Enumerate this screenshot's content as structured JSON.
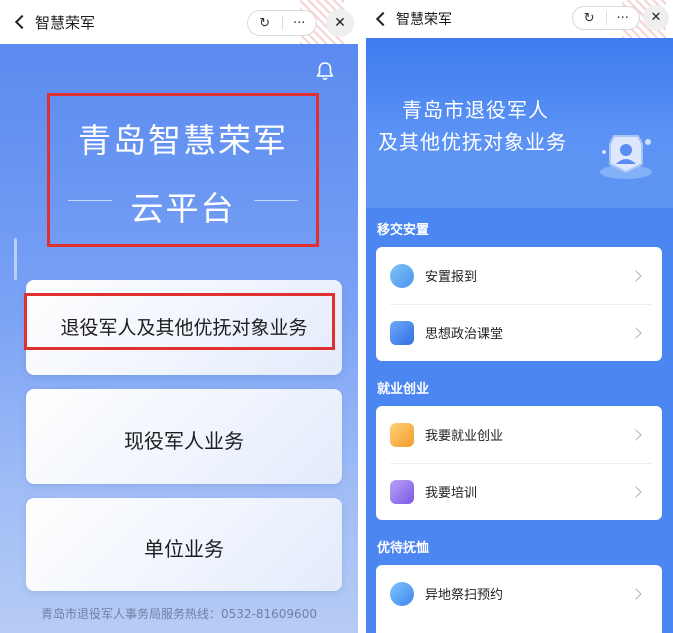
{
  "left": {
    "header_title": "智慧荣军",
    "refresh_glyph": "↻",
    "more_glyph": "···",
    "close_glyph": "✕",
    "title_line1": "青岛智慧荣军",
    "title_line2": "云平台",
    "cards": [
      {
        "label": "退役军人及其他优抚对象业务"
      },
      {
        "label": "现役军人业务"
      },
      {
        "label": "单位业务"
      }
    ],
    "footer": "青岛市退役军人事务局服务热线：0532-81609600"
  },
  "right": {
    "header_title": "智慧荣军",
    "refresh_glyph": "↻",
    "more_glyph": "···",
    "close_glyph": "✕",
    "banner_line1": "青岛市退役军人",
    "banner_line2": "及其他优抚对象业务",
    "sections": [
      {
        "title": "移交安置",
        "items": [
          {
            "label": "安置报到",
            "icon": "person-checkin-icon"
          },
          {
            "label": "思想政治课堂",
            "icon": "video-class-icon"
          }
        ]
      },
      {
        "title": "就业创业",
        "items": [
          {
            "label": "我要就业创业",
            "icon": "briefcase-icon"
          },
          {
            "label": "我要培训",
            "icon": "book-icon"
          }
        ]
      },
      {
        "title": "优待抚恤",
        "items": [
          {
            "label": "异地祭扫预约",
            "icon": "memorial-icon"
          }
        ]
      }
    ]
  },
  "colors": {
    "accent_blue": "#4c86f1",
    "highlight_red": "#e03030",
    "card_text": "#1e1e1e"
  }
}
